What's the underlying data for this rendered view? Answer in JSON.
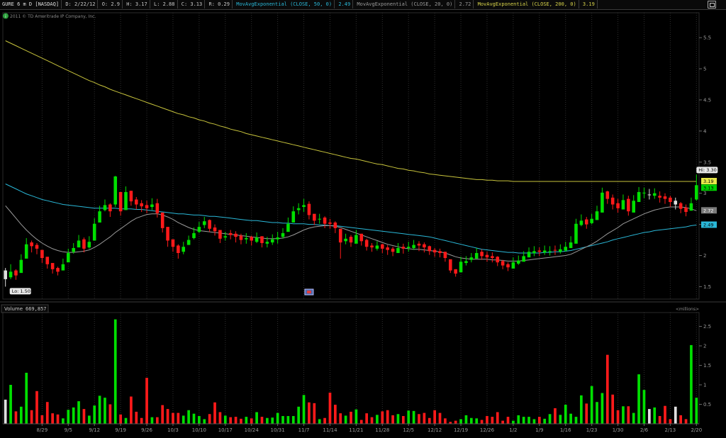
{
  "header": {
    "symbol": "GURE 6 m D [NASDAQ]",
    "date": "D: 2/22/12",
    "open": "O: 2.9",
    "high": "H: 3.17",
    "low": "L: 2.88",
    "close": "C: 3.13",
    "range": "R: 0.29",
    "ma50_label": "MovAvgExponential (CLOSE, 50, 0)",
    "ma50_value": "2.49",
    "ma20_label": "MovAvgExponential (CLOSE, 20, 0)",
    "ma20_value": "2.72",
    "ma200_label": "MovAvgExponential (CLOSE, 200, 0)",
    "ma200_value": "3.19"
  },
  "copyright": "2011 © TD Ameritrade IP Company, Inc.",
  "volume_header": {
    "label": "Volume",
    "value": "669,857",
    "units": "<millions>"
  },
  "colors": {
    "up": "#00e000",
    "down": "#ff1a1a",
    "neutral": "#e0e0e0",
    "ma200": "#c8c43c",
    "ma50": "#2ab8d8",
    "ma20": "#9a9a9a",
    "grid": "#303030"
  },
  "icons": {
    "dividend": "dividend-icon"
  },
  "chart_data": [
    {
      "type": "candlestick",
      "title": "GURE 6 m D [NASDAQ]",
      "ylim": [
        1.3,
        5.9
      ],
      "y_ticks": [
        1.5,
        2,
        2.5,
        3,
        3.5,
        4,
        4.5,
        5,
        5.5
      ],
      "y_tick_labels": [
        "1.5",
        "2",
        "2.5",
        "3",
        "3.5",
        "4",
        "4.5",
        "5",
        "5.5"
      ],
      "x_tick_labels": [
        "8/29",
        "9/5",
        "9/12",
        "9/19",
        "9/26",
        "10/3",
        "10/10",
        "10/17",
        "10/24",
        "10/31",
        "11/7",
        "11/14",
        "11/21",
        "11/28",
        "12/5",
        "12/12",
        "12/19",
        "12/26",
        "1/2",
        "1/9",
        "1/16",
        "1/23",
        "1/30",
        "2/6",
        "2/13",
        "2/20"
      ],
      "x_tick_index": [
        7,
        12,
        17,
        22,
        27,
        32,
        37,
        42,
        47,
        52,
        57,
        62,
        67,
        72,
        77,
        82,
        87,
        92,
        97,
        102,
        107,
        112,
        117,
        122,
        127,
        132
      ],
      "close": [
        1.62,
        1.74,
        1.68,
        1.93,
        2.18,
        2.15,
        2.11,
        1.96,
        1.86,
        1.78,
        1.74,
        1.86,
        2.04,
        2.12,
        2.24,
        2.11,
        2.22,
        2.51,
        2.71,
        2.81,
        2.71,
        3.27,
        2.71,
        3.02,
        2.87,
        2.82,
        2.79,
        2.76,
        2.82,
        2.68,
        2.44,
        2.24,
        2.14,
        2.04,
        2.14,
        2.25,
        2.36,
        2.46,
        2.55,
        2.43,
        2.39,
        2.27,
        2.31,
        2.33,
        2.3,
        2.25,
        2.28,
        2.24,
        2.29,
        2.2,
        2.22,
        2.26,
        2.29,
        2.36,
        2.51,
        2.71,
        2.76,
        2.81,
        2.65,
        2.56,
        2.59,
        2.51,
        2.51,
        2.44,
        2.21,
        2.27,
        2.21,
        2.33,
        2.23,
        2.14,
        2.13,
        2.16,
        2.11,
        2.09,
        2.06,
        2.12,
        2.11,
        2.14,
        2.17,
        2.16,
        2.13,
        2.07,
        2.05,
        2.04,
        1.96,
        1.76,
        1.71,
        1.9,
        1.91,
        1.97,
        2.04,
        1.99,
        1.97,
        1.96,
        1.89,
        1.84,
        1.81,
        1.89,
        1.92,
        1.99,
        2.06,
        2.07,
        2.06,
        2.08,
        2.07,
        2.08,
        2.1,
        2.14,
        2.21,
        2.51,
        2.56,
        2.5,
        2.59,
        2.71,
        3.01,
        2.91,
        2.82,
        2.76,
        2.89,
        2.71,
        2.88,
        3.02,
        3.01,
        2.98,
        3.0,
        2.93,
        2.91,
        2.86,
        2.82,
        2.75,
        2.7,
        2.84,
        3.13
      ],
      "high": [
        1.8,
        1.86,
        1.78,
        2.02,
        2.28,
        2.24,
        2.2,
        2.06,
        1.94,
        1.86,
        1.82,
        1.95,
        2.11,
        2.2,
        2.33,
        2.29,
        2.31,
        2.6,
        2.8,
        2.9,
        2.84,
        3.28,
        2.91,
        3.11,
        3.04,
        2.94,
        2.89,
        2.88,
        2.92,
        2.91,
        2.69,
        2.39,
        2.24,
        2.18,
        2.22,
        2.32,
        2.45,
        2.54,
        2.62,
        2.58,
        2.5,
        2.39,
        2.38,
        2.41,
        2.39,
        2.35,
        2.36,
        2.32,
        2.37,
        2.3,
        2.3,
        2.34,
        2.38,
        2.44,
        2.61,
        2.79,
        2.84,
        2.91,
        2.87,
        2.66,
        2.67,
        2.63,
        2.59,
        2.55,
        2.42,
        2.35,
        2.33,
        2.41,
        2.35,
        2.27,
        2.2,
        2.23,
        2.19,
        2.17,
        2.14,
        2.2,
        2.19,
        2.22,
        2.25,
        2.23,
        2.21,
        2.16,
        2.12,
        2.11,
        2.06,
        1.93,
        1.78,
        1.98,
        1.99,
        2.04,
        2.12,
        2.1,
        2.06,
        2.05,
        1.99,
        1.93,
        1.89,
        1.97,
        2.0,
        2.07,
        2.13,
        2.15,
        2.13,
        2.16,
        2.15,
        2.16,
        2.18,
        2.22,
        2.31,
        2.59,
        2.66,
        2.62,
        2.67,
        2.8,
        3.09,
        3.04,
        2.98,
        2.91,
        2.98,
        2.96,
        2.97,
        3.1,
        3.09,
        3.07,
        3.08,
        3.03,
        3.0,
        2.96,
        2.93,
        2.86,
        2.82,
        2.93,
        3.3
      ],
      "low": [
        1.5,
        1.62,
        1.61,
        1.85,
        2.09,
        2.05,
        2.02,
        1.88,
        1.79,
        1.71,
        1.68,
        1.79,
        1.95,
        2.03,
        2.15,
        2.05,
        2.11,
        2.4,
        2.61,
        2.71,
        2.62,
        2.78,
        2.64,
        2.89,
        2.8,
        2.74,
        2.7,
        2.68,
        2.73,
        2.61,
        2.37,
        2.14,
        2.06,
        1.95,
        2.02,
        2.17,
        2.26,
        2.36,
        2.44,
        2.38,
        2.32,
        2.2,
        2.24,
        2.26,
        2.21,
        2.18,
        2.19,
        2.16,
        2.2,
        2.13,
        2.13,
        2.17,
        2.19,
        2.27,
        2.4,
        2.6,
        2.66,
        2.7,
        2.58,
        2.49,
        2.51,
        2.44,
        2.43,
        2.36,
        1.95,
        2.18,
        2.14,
        2.23,
        2.16,
        2.08,
        2.06,
        2.08,
        2.04,
        2.01,
        1.99,
        2.04,
        2.03,
        2.06,
        2.09,
        2.07,
        2.05,
        2.01,
        1.98,
        1.97,
        1.9,
        1.72,
        1.66,
        1.81,
        1.84,
        1.89,
        1.96,
        1.93,
        1.9,
        1.89,
        1.83,
        1.78,
        1.75,
        1.81,
        1.85,
        1.91,
        1.98,
        1.99,
        1.99,
        2.01,
        2.0,
        2.01,
        2.03,
        2.06,
        2.12,
        2.4,
        2.47,
        2.43,
        2.5,
        2.61,
        2.91,
        2.83,
        2.74,
        2.69,
        2.79,
        2.64,
        2.81,
        2.93,
        2.92,
        2.9,
        2.91,
        2.85,
        2.83,
        2.78,
        2.74,
        2.68,
        2.63,
        2.76,
        2.88
      ],
      "open": [
        1.76,
        1.65,
        1.76,
        1.72,
        1.95,
        2.21,
        2.17,
        2.09,
        1.98,
        1.88,
        1.8,
        1.76,
        1.89,
        2.06,
        2.13,
        2.26,
        2.13,
        2.24,
        2.53,
        2.73,
        2.82,
        2.82,
        3.02,
        2.73,
        3.04,
        2.9,
        2.84,
        2.81,
        2.78,
        2.84,
        2.69,
        2.46,
        2.26,
        2.16,
        2.06,
        2.17,
        2.28,
        2.38,
        2.49,
        2.57,
        2.45,
        2.41,
        2.29,
        2.36,
        2.35,
        2.32,
        2.26,
        2.3,
        2.22,
        2.31,
        2.19,
        2.21,
        2.26,
        2.3,
        2.38,
        2.53,
        2.73,
        2.78,
        2.83,
        2.67,
        2.58,
        2.61,
        2.53,
        2.53,
        2.43,
        2.23,
        2.3,
        2.19,
        2.35,
        2.25,
        2.16,
        2.11,
        2.18,
        2.13,
        2.11,
        2.04,
        2.14,
        2.12,
        2.12,
        2.19,
        2.18,
        2.15,
        2.09,
        2.07,
        2.06,
        1.94,
        1.78,
        1.73,
        1.88,
        1.93,
        1.95,
        2.06,
        2.01,
        1.99,
        1.98,
        1.91,
        1.86,
        1.79,
        1.87,
        1.9,
        1.97,
        2.04,
        2.08,
        2.05,
        2.06,
        2.09,
        2.06,
        2.08,
        2.12,
        2.19,
        2.49,
        2.58,
        2.52,
        2.57,
        2.69,
        3.03,
        2.93,
        2.84,
        2.74,
        2.91,
        2.69,
        2.86,
        3.0,
        2.98,
        2.96,
        2.96,
        2.95,
        2.93,
        2.88,
        2.84,
        2.77,
        2.72,
        2.9
      ]
    },
    {
      "type": "line",
      "series": [
        {
          "name": "MovAvgExponential (CLOSE, 200, 0)",
          "start": 5.45,
          "end": 3.19
        },
        {
          "name": "MovAvgExponential (CLOSE, 50, 0)",
          "start": 3.15,
          "end": 2.49
        },
        {
          "name": "MovAvgExponential (CLOSE, 20, 0)",
          "start": 2.8,
          "end": 2.72
        }
      ],
      "ma200": [
        5.45,
        5.41,
        5.37,
        5.33,
        5.29,
        5.25,
        5.21,
        5.17,
        5.13,
        5.09,
        5.05,
        5.01,
        4.97,
        4.93,
        4.89,
        4.85,
        4.81,
        4.78,
        4.74,
        4.71,
        4.67,
        4.64,
        4.61,
        4.58,
        4.55,
        4.52,
        4.49,
        4.46,
        4.43,
        4.4,
        4.37,
        4.34,
        4.31,
        4.28,
        4.26,
        4.23,
        4.21,
        4.18,
        4.16,
        4.13,
        4.11,
        4.08,
        4.06,
        4.03,
        4.01,
        3.99,
        3.96,
        3.94,
        3.92,
        3.9,
        3.88,
        3.86,
        3.84,
        3.82,
        3.8,
        3.78,
        3.76,
        3.74,
        3.72,
        3.7,
        3.68,
        3.66,
        3.64,
        3.62,
        3.6,
        3.58,
        3.56,
        3.55,
        3.53,
        3.51,
        3.49,
        3.47,
        3.46,
        3.44,
        3.42,
        3.4,
        3.39,
        3.37,
        3.36,
        3.34,
        3.33,
        3.31,
        3.3,
        3.29,
        3.28,
        3.27,
        3.26,
        3.25,
        3.24,
        3.23,
        3.22,
        3.22,
        3.21,
        3.21,
        3.2,
        3.2,
        3.2,
        3.19,
        3.19,
        3.19,
        3.19,
        3.19,
        3.19,
        3.19,
        3.19,
        3.19,
        3.19,
        3.19,
        3.19,
        3.19,
        3.19,
        3.19,
        3.19,
        3.19,
        3.19,
        3.19,
        3.19,
        3.19,
        3.19,
        3.19,
        3.19,
        3.19,
        3.19,
        3.19,
        3.19,
        3.19,
        3.19,
        3.19,
        3.19,
        3.19,
        3.19,
        3.19,
        3.19
      ],
      "ma50": [
        3.15,
        3.11,
        3.07,
        3.03,
        2.99,
        2.96,
        2.93,
        2.9,
        2.88,
        2.86,
        2.84,
        2.82,
        2.81,
        2.8,
        2.79,
        2.78,
        2.77,
        2.76,
        2.76,
        2.76,
        2.76,
        2.76,
        2.75,
        2.75,
        2.75,
        2.74,
        2.74,
        2.73,
        2.72,
        2.71,
        2.7,
        2.69,
        2.68,
        2.67,
        2.67,
        2.66,
        2.65,
        2.65,
        2.64,
        2.63,
        2.63,
        2.62,
        2.61,
        2.6,
        2.59,
        2.58,
        2.57,
        2.56,
        2.56,
        2.55,
        2.54,
        2.53,
        2.53,
        2.52,
        2.52,
        2.51,
        2.51,
        2.51,
        2.5,
        2.5,
        2.49,
        2.49,
        2.48,
        2.48,
        2.47,
        2.46,
        2.45,
        2.44,
        2.43,
        2.42,
        2.41,
        2.4,
        2.39,
        2.38,
        2.37,
        2.36,
        2.35,
        2.34,
        2.33,
        2.32,
        2.31,
        2.3,
        2.28,
        2.26,
        2.24,
        2.22,
        2.2,
        2.18,
        2.16,
        2.14,
        2.12,
        2.1,
        2.09,
        2.08,
        2.07,
        2.06,
        2.05,
        2.05,
        2.04,
        2.04,
        2.04,
        2.04,
        2.04,
        2.05,
        2.05,
        2.06,
        2.06,
        2.07,
        2.08,
        2.1,
        2.12,
        2.14,
        2.16,
        2.18,
        2.2,
        2.22,
        2.25,
        2.27,
        2.29,
        2.31,
        2.33,
        2.35,
        2.37,
        2.38,
        2.4,
        2.41,
        2.42,
        2.43,
        2.44,
        2.45,
        2.46,
        2.48,
        2.49
      ],
      "ma20": [
        2.8,
        2.7,
        2.6,
        2.5,
        2.41,
        2.33,
        2.26,
        2.2,
        2.15,
        2.11,
        2.08,
        2.06,
        2.05,
        2.05,
        2.06,
        2.07,
        2.09,
        2.13,
        2.18,
        2.24,
        2.3,
        2.37,
        2.43,
        2.49,
        2.55,
        2.6,
        2.63,
        2.66,
        2.67,
        2.67,
        2.65,
        2.62,
        2.58,
        2.53,
        2.49,
        2.45,
        2.42,
        2.4,
        2.39,
        2.38,
        2.37,
        2.36,
        2.35,
        2.34,
        2.33,
        2.32,
        2.31,
        2.3,
        2.29,
        2.28,
        2.27,
        2.27,
        2.27,
        2.28,
        2.3,
        2.33,
        2.37,
        2.41,
        2.44,
        2.46,
        2.47,
        2.48,
        2.48,
        2.47,
        2.45,
        2.42,
        2.39,
        2.36,
        2.33,
        2.3,
        2.27,
        2.24,
        2.21,
        2.18,
        2.16,
        2.14,
        2.12,
        2.11,
        2.1,
        2.1,
        2.09,
        2.08,
        2.07,
        2.06,
        2.04,
        2.01,
        1.98,
        1.96,
        1.95,
        1.94,
        1.94,
        1.94,
        1.94,
        1.93,
        1.93,
        1.92,
        1.91,
        1.91,
        1.91,
        1.92,
        1.93,
        1.94,
        1.95,
        1.96,
        1.97,
        1.98,
        1.99,
        2.0,
        2.02,
        2.06,
        2.1,
        2.14,
        2.18,
        2.23,
        2.29,
        2.35,
        2.4,
        2.45,
        2.51,
        2.55,
        2.59,
        2.63,
        2.67,
        2.7,
        2.73,
        2.75,
        2.77,
        2.78,
        2.78,
        2.78,
        2.77,
        2.75,
        2.72
      ]
    },
    {
      "type": "bar",
      "title": "Volume",
      "units": "<millions>",
      "ylim": [
        0,
        2.8
      ],
      "y_ticks": [
        0.5,
        1,
        1.5,
        2,
        2.5
      ],
      "y_tick_labels": [
        "0.5",
        "1",
        "1.5",
        "2",
        "2.5"
      ],
      "values": [
        0.62,
        1.0,
        0.32,
        0.44,
        1.31,
        0.35,
        0.84,
        0.22,
        0.56,
        0.27,
        0.24,
        0.14,
        0.36,
        0.42,
        0.58,
        0.38,
        0.21,
        0.47,
        0.72,
        0.67,
        0.5,
        2.68,
        0.24,
        0.15,
        0.7,
        0.31,
        0.15,
        1.18,
        0.17,
        0.17,
        0.48,
        0.38,
        0.28,
        0.28,
        0.21,
        0.35,
        0.26,
        0.2,
        0.12,
        0.25,
        0.55,
        0.3,
        0.21,
        0.17,
        0.18,
        0.13,
        0.18,
        0.14,
        0.3,
        0.18,
        0.15,
        0.16,
        0.28,
        0.2,
        0.2,
        0.2,
        0.44,
        0.74,
        0.55,
        0.53,
        0.12,
        0.15,
        0.8,
        0.49,
        0.27,
        0.21,
        0.31,
        0.37,
        0.1,
        0.27,
        0.17,
        0.23,
        0.32,
        0.35,
        0.22,
        0.25,
        0.2,
        0.34,
        0.33,
        0.25,
        0.28,
        0.15,
        0.35,
        0.28,
        0.14,
        0.05,
        0.08,
        0.12,
        0.22,
        0.15,
        0.14,
        0.1,
        0.2,
        0.18,
        0.3,
        0.08,
        0.18,
        0.08,
        0.22,
        0.18,
        0.18,
        0.12,
        0.18,
        0.13,
        0.25,
        0.4,
        0.23,
        0.49,
        0.26,
        0.18,
        0.73,
        0.52,
        0.97,
        0.56,
        0.79,
        1.77,
        0.75,
        0.35,
        0.45,
        0.45,
        0.28,
        1.27,
        0.87,
        0.38,
        0.42,
        0.2,
        0.46,
        0.12,
        0.44,
        0.22,
        0.12,
        2.02,
        0.67
      ]
    }
  ]
}
